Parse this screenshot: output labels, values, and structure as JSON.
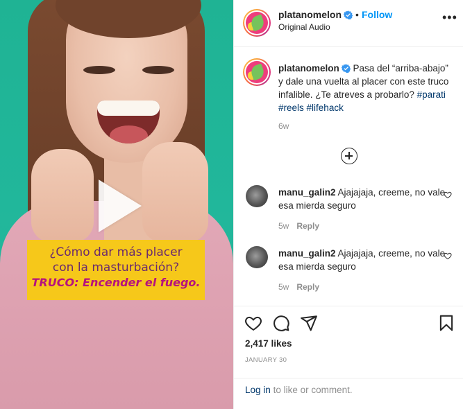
{
  "media": {
    "caption_line1": "¿Cómo dar más placer",
    "caption_line2": "con la masturbación?",
    "caption_line3": "TRUCO: Encender el fuego."
  },
  "header": {
    "username": "platanomelon",
    "separator": "•",
    "follow_label": "Follow",
    "subtitle": "Original Audio",
    "more": "•••"
  },
  "caption": {
    "username": "platanomelon",
    "text": "Pasa del “arriba-abajo” y dale una vuelta al placer con este truco infalible. ¿Te atreves a probarlo?",
    "hashtags": [
      "#parati",
      "#reels",
      "#lifehack"
    ],
    "time": "6w"
  },
  "comments": [
    {
      "username": "manu_galin2",
      "text": "Ajajajaja, creeme, no vale esa mierda seguro",
      "time": "5w",
      "reply_label": "Reply"
    },
    {
      "username": "manu_galin2",
      "text": "Ajajajaja, creeme, no vale esa mierda seguro",
      "time": "5w",
      "reply_label": "Reply"
    }
  ],
  "actions": {
    "likes": "2,417 likes",
    "date": "JANUARY 30"
  },
  "login": {
    "link": "Log in",
    "rest": "to like or comment."
  },
  "colors": {
    "accent": "#0095f6",
    "hashtag": "#00376b",
    "caption_box": "#f6c81a",
    "background_green": "#21b79b"
  }
}
